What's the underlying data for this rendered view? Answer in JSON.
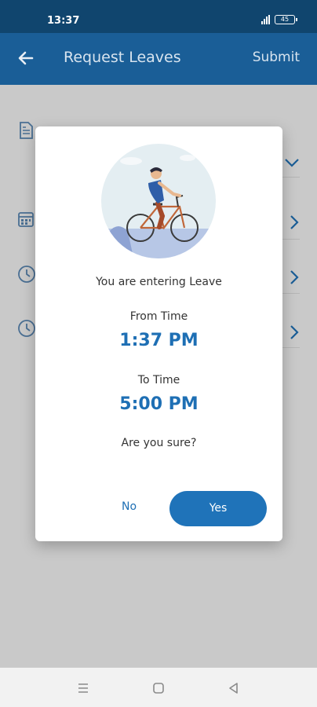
{
  "status_bar": {
    "time": "13:37",
    "battery": "45"
  },
  "app_bar": {
    "title": "Request Leaves",
    "submit_label": "Submit"
  },
  "dialog": {
    "entering_text": "You are entering Leave",
    "from_label": "From Time",
    "from_value": "1:37 PM",
    "to_label": "To Time",
    "to_value": "5:00 PM",
    "question": "Are you sure?",
    "no_label": "No",
    "yes_label": "Yes"
  },
  "colors": {
    "primary": "#1a5e97",
    "status_bar": "#10456e",
    "accent": "#1e6fb4",
    "overlay": "#c9c9c9"
  },
  "icons": [
    "back-arrow-icon",
    "document-icon",
    "calendar-icon",
    "clock-icon",
    "chevron-down-icon",
    "chevron-right-icon",
    "menu-icon",
    "home-icon",
    "back-triangle-icon"
  ]
}
